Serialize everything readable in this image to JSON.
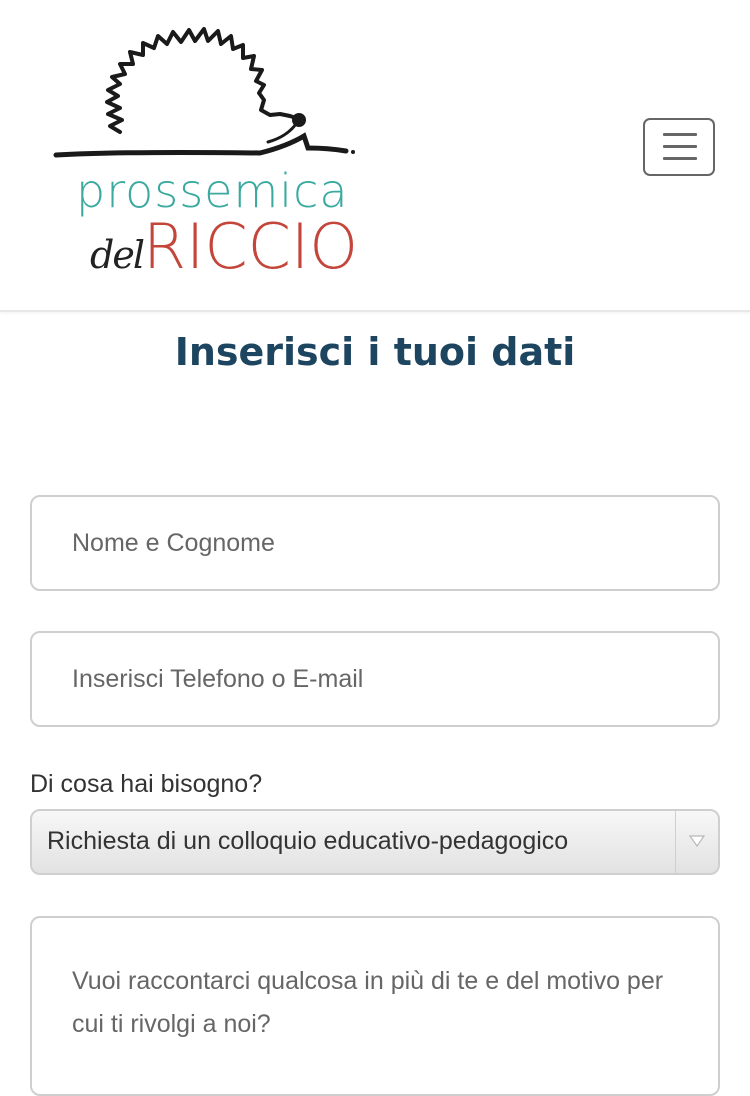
{
  "header": {
    "logo": {
      "word1": "prossemica",
      "word2_prefix": "del",
      "word2_main": "RICCIO"
    },
    "menu_icon": "hamburger-menu-icon"
  },
  "form": {
    "title": "Inserisci i tuoi dati",
    "name_placeholder": "Nome e Cognome",
    "contact_placeholder": "Inserisci Telefono o E-mail",
    "need_label": "Di cosa hai bisogno?",
    "need_selected": "Richiesta di un colloquio educativo-pedagogico",
    "message_placeholder": "Vuoi raccontarci qualcosa in più di te e del motivo per cui ti rivolgi a noi?"
  },
  "colors": {
    "title": "#1d4560",
    "logo_teal": "#3aa99f",
    "logo_red": "#c4453a",
    "border": "#cfcfcf"
  }
}
